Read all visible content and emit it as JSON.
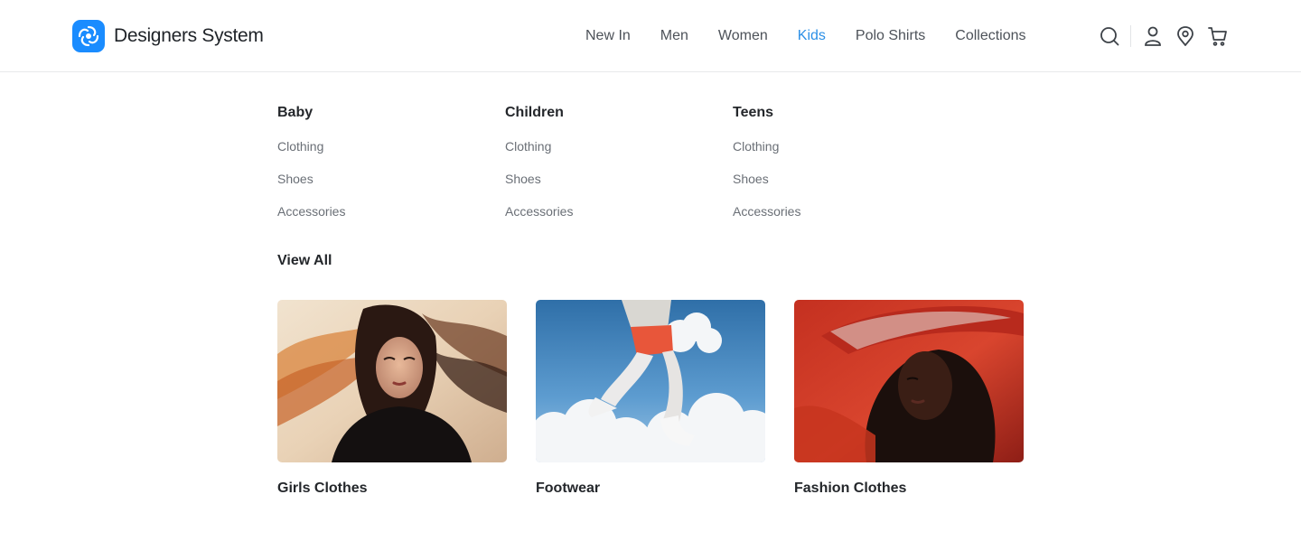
{
  "brand": {
    "name": "Designers System",
    "logo_icon": "swirl-logo-icon",
    "accent": "#1a8cff"
  },
  "nav": {
    "items": [
      {
        "label": "New In"
      },
      {
        "label": "Men"
      },
      {
        "label": "Women"
      },
      {
        "label": "Kids",
        "active": true
      },
      {
        "label": "Polo Shirts"
      },
      {
        "label": "Collections"
      }
    ],
    "active_color": "#2b8fe6"
  },
  "header_icons": [
    "search-icon",
    "user-icon",
    "location-pin-icon",
    "cart-icon"
  ],
  "mega_menu": {
    "columns": [
      {
        "title": "Baby",
        "links": [
          "Clothing",
          "Shoes",
          "Accessories"
        ]
      },
      {
        "title": "Children",
        "links": [
          "Clothing",
          "Shoes",
          "Accessories"
        ]
      },
      {
        "title": "Teens",
        "links": [
          "Clothing",
          "Shoes",
          "Accessories"
        ]
      }
    ],
    "view_all": "View All",
    "cards": [
      {
        "label": "Girls Clothes"
      },
      {
        "label": "Footwear"
      },
      {
        "label": "Fashion Clothes"
      }
    ]
  }
}
